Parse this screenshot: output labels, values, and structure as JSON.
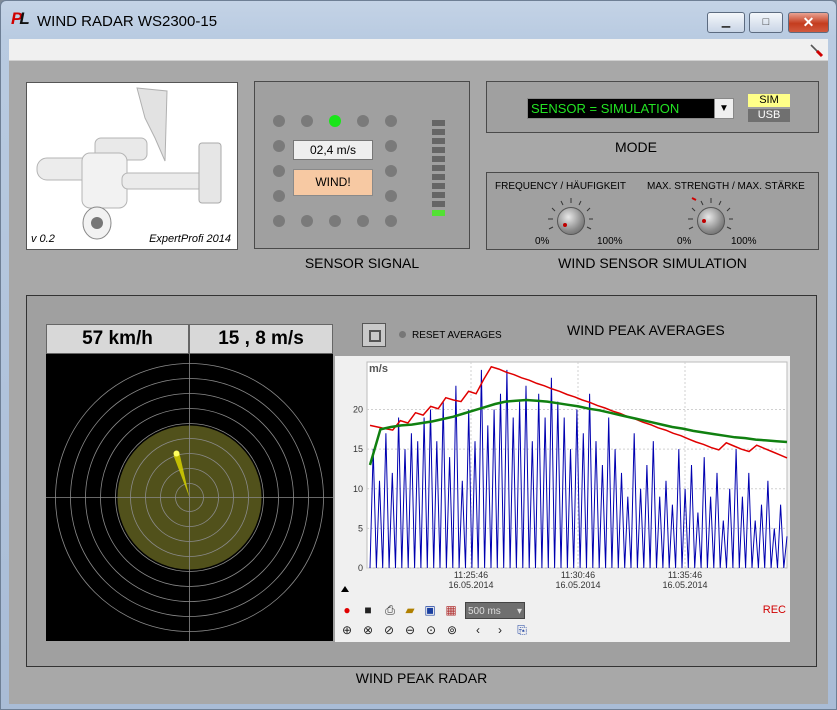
{
  "window": {
    "title": "WIND RADAR WS2300-15",
    "logo_p": "P",
    "logo_l": "L"
  },
  "controls": {
    "minimize": "▁",
    "maximize": "□",
    "close": "✕"
  },
  "menubar": {
    "icon": "screwdriver-icon"
  },
  "picture": {
    "version": "v 0.2",
    "credit": "ExpertProfi 2014"
  },
  "sensor": {
    "speed": "02,4  m/s",
    "wind_button": "WIND!",
    "caption": "SENSOR SIGNAL",
    "bar_level": 0.11
  },
  "mode": {
    "selected": "SENSOR = SIMULATION",
    "sim": "SIM",
    "usb": "USB",
    "caption": "MODE"
  },
  "simulation": {
    "caption": "WIND SENSOR SIMULATION",
    "frequency": {
      "label": "FREQUENCY / HÄUFIGKEIT",
      "min": "0%",
      "max": "100%",
      "level": 0.1
    },
    "strength": {
      "label": "MAX. STRENGTH / MAX. STÄRKE",
      "min": "0%",
      "max": "100%",
      "level": 0.05
    }
  },
  "readout": {
    "kmh": "57  km/h",
    "ms": "15 , 8  m/s"
  },
  "reset": {
    "label": "RESET AVERAGES"
  },
  "peak": {
    "title": "WIND PEAK AVERAGES",
    "caption": "WIND PEAK RADAR"
  },
  "toolbar": {
    "interval": "500 ms",
    "rec": "REC",
    "prev": "‹",
    "next": "›"
  },
  "colors": {
    "peak": "#0000b0",
    "max": "#e00000",
    "average": "#108010",
    "radar_bg": "#000000",
    "radar_grid": "#8a8a8a",
    "radar_fill": "#5a5a1e"
  },
  "chart_data": {
    "type": "line",
    "ylabel": "m/s",
    "ylim": [
      0,
      26
    ],
    "yticks": [
      "0",
      "5",
      "10",
      "15",
      "20"
    ],
    "xticks": [
      {
        "time": "11:25:46",
        "date": "16.05.2014"
      },
      {
        "time": "11:30:46",
        "date": "16.05.2014"
      },
      {
        "time": "11:35:46",
        "date": "16.05.2014"
      }
    ],
    "series": [
      {
        "key": "peaks",
        "values": [
          0,
          15,
          0,
          11,
          0,
          17,
          0,
          12,
          0,
          19,
          0,
          15,
          0,
          17,
          0,
          16,
          0,
          19,
          0,
          20,
          0,
          16,
          0,
          21,
          0,
          14,
          0,
          23,
          0,
          11,
          0,
          20,
          0,
          16,
          0,
          25,
          0,
          18,
          0,
          20,
          0,
          22,
          0,
          25,
          0,
          19,
          0,
          21,
          0,
          23,
          0,
          16,
          0,
          22,
          0,
          19,
          0,
          24,
          0,
          21,
          0,
          19,
          0,
          15,
          0,
          20,
          0,
          17,
          0,
          22,
          0,
          16,
          0,
          13,
          0,
          19,
          0,
          15,
          0,
          12,
          0,
          9,
          0,
          17,
          0,
          10,
          0,
          13,
          0,
          16,
          0,
          9,
          0,
          11,
          0,
          8,
          0,
          15,
          0,
          10,
          0,
          13,
          0,
          7,
          0,
          14,
          0,
          9,
          0,
          12,
          0,
          6,
          0,
          10,
          0,
          15,
          0,
          9,
          0,
          12,
          0,
          6,
          0,
          8,
          0,
          11,
          0,
          5,
          0,
          8,
          0,
          4
        ]
      },
      {
        "key": "max",
        "values": [
          18,
          17.8,
          17.6,
          17.4,
          18.6,
          18.3,
          19.6,
          19.3,
          20.4,
          20.1,
          21.5,
          21.2,
          21.0,
          22.3,
          22.0,
          23.8,
          25.4,
          25.1,
          24.7,
          24.4,
          24.0,
          23.7,
          23.3,
          23.0,
          22.6,
          22.3,
          21.9,
          21.6,
          21.2,
          20.9,
          20.5,
          20.2,
          19.8,
          19.5,
          19.1,
          18.8,
          18.4,
          18.1,
          17.7,
          17.4,
          17.0,
          16.7,
          16.3,
          15.9,
          15.6,
          15.2,
          14.9,
          15.8,
          15.4,
          15.0,
          14.7,
          15.5,
          15.1,
          14.7,
          14.3,
          13.9
        ]
      },
      {
        "key": "average",
        "values": [
          13,
          17.5,
          17.8,
          18.0,
          18.1,
          18.3,
          18.5,
          18.8,
          19.1,
          19.5,
          19.9,
          20.3,
          20.7,
          21.0,
          21.1,
          21.2,
          21.1,
          21.0,
          20.8,
          20.6,
          20.4,
          20.1,
          19.9,
          19.6,
          19.3,
          19.0,
          18.7,
          18.4,
          18.1,
          17.8,
          17.6,
          17.3,
          17.1,
          16.9,
          16.7,
          16.5,
          16.4,
          16.2,
          16.1,
          16.0,
          15.9
        ]
      }
    ]
  }
}
